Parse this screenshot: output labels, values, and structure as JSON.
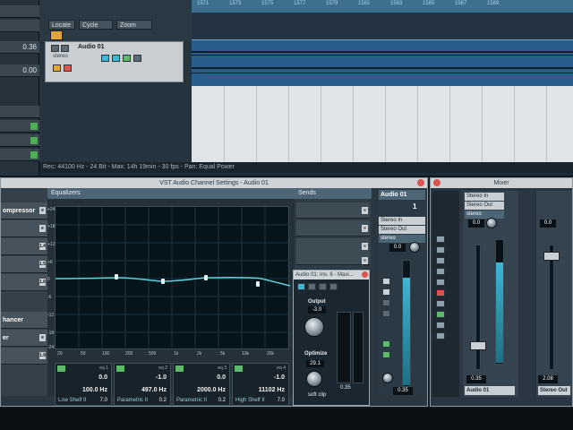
{
  "project": {
    "toolbar": {
      "locate": "Locate",
      "cycle": "Cycle",
      "zoom": "Zoom"
    },
    "rack_values": [
      "0.36",
      "0.00"
    ],
    "track": {
      "name": "Audio 01",
      "mode": "stereo"
    },
    "ruler_numbers": [
      "1571",
      "1573",
      "1575",
      "1577",
      "1579",
      "1581",
      "1583",
      "1585",
      "1587",
      "1589"
    ],
    "status": "Rec: 44100 Hz - 24 Bit - Max: 14h 19min - 30 fps - Pan: Equal Power"
  },
  "channel_settings": {
    "title": "VST Audio Channel Settings - Audio 01",
    "inserts": [
      {
        "label": "ompressor",
        "mark": "e"
      },
      {
        "label": "",
        "mark": "e"
      },
      {
        "label": "",
        "mark": "1.4"
      },
      {
        "label": "",
        "mark": "1.5"
      },
      {
        "label": "",
        "mark": "1.6"
      },
      {
        "label": "hancer",
        "mark": ""
      },
      {
        "label": "er",
        "mark": "e"
      },
      {
        "label": "",
        "mark": "1.9"
      }
    ],
    "equalizers_label": "Equalizers",
    "eq_db_labels": [
      "+24",
      "+18",
      "+12",
      "+6",
      "0",
      "-6",
      "-12",
      "-18",
      "-24"
    ],
    "eq_freq_labels": [
      "20",
      "50",
      "100",
      "200",
      "500",
      "1k",
      "2k",
      "5k",
      "10k",
      "20k"
    ],
    "bands": [
      {
        "num": "eq 1",
        "gain": "0.0",
        "freq": "100.0 Hz",
        "type": "Low Shelf II",
        "q": "7.0"
      },
      {
        "num": "eq 2",
        "gain": "-1.0",
        "freq": "497.0 Hz",
        "type": "Parametric II",
        "q": "0.2"
      },
      {
        "num": "eq 3",
        "gain": "0.0",
        "freq": "2000.0 Hz",
        "type": "Parametric II",
        "q": "0.2"
      },
      {
        "num": "eq 4",
        "gain": "-1.0",
        "freq": "11102 Hz",
        "type": "High Shelf II",
        "q": "7.0"
      }
    ],
    "sends_label": "Sends",
    "send_marks": [
      "e",
      "e",
      "e",
      "e"
    ],
    "plugin": {
      "title": "Audio 01: Ins. 6 - Maxi...",
      "output_label": "Output",
      "output_value": "-3.0",
      "optimize_label": "Optimize",
      "optimize_value": "29.1",
      "softclip": "soft clip",
      "meter_value": "0.35"
    },
    "strip": {
      "name": "Audio 01",
      "channel_num": "1",
      "input": "Stereo In",
      "output": "Stereo Out",
      "mode": "stereo",
      "pan": "0.0",
      "level": "0.35"
    }
  },
  "mixer": {
    "title": "Mixer",
    "strip1": {
      "input": "Stereo In",
      "output": "Stereo Out",
      "mode": "stereo",
      "pan": "0.0",
      "level": "0.35",
      "name": "Audio 01"
    },
    "strip2": {
      "pan": "0.0",
      "level": "2.08",
      "name": "Stereo Out"
    }
  },
  "colors": {
    "eq_curve": "#5fd3d6",
    "accent_blue": "#3fb6d4",
    "button_green": "#5fb86b",
    "close_red": "#d9534f"
  },
  "fader_level_fraction": 0.85
}
